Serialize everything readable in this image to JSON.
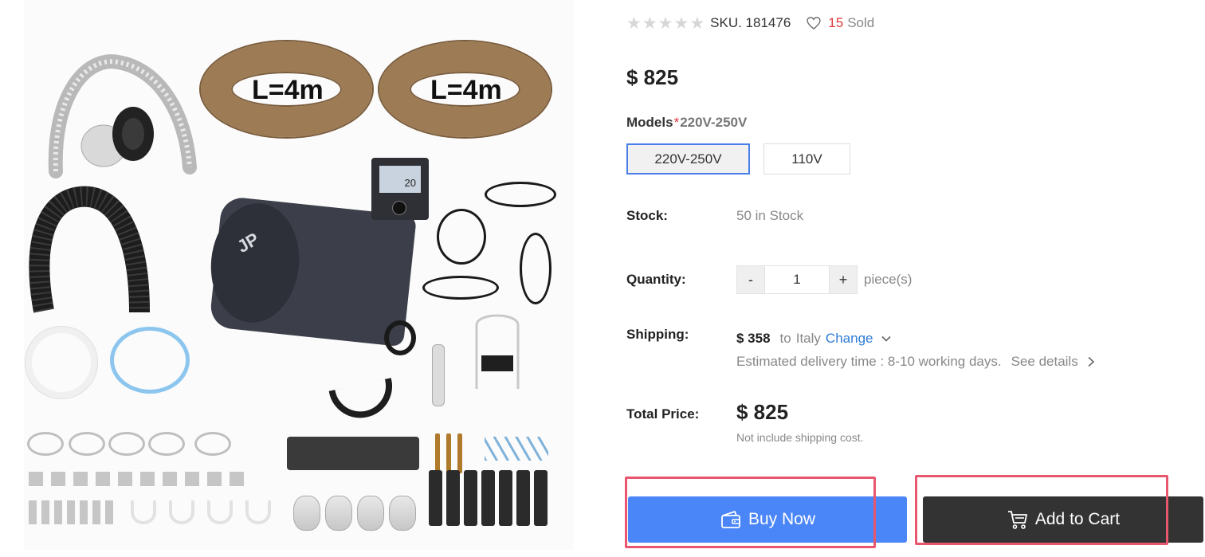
{
  "product": {
    "image_alt_text": "L=4m",
    "thermostat_display": "20",
    "heater_brand": "JP"
  },
  "meta": {
    "rating": 0,
    "max_rating": 5,
    "sku": "SKU. 181476",
    "sold_count": "15",
    "sold_label": "Sold"
  },
  "price": "$ 825",
  "models": {
    "label": "Models",
    "required_mark": "*",
    "selected": "220V-250V",
    "options": [
      "220V-250V",
      "110V"
    ]
  },
  "stock": {
    "label": "Stock:",
    "value": "50 in Stock"
  },
  "quantity": {
    "label": "Quantity:",
    "minus": "-",
    "value": "1",
    "plus": "+",
    "unit": "piece(s)"
  },
  "shipping": {
    "label": "Shipping:",
    "price": "$ 358",
    "to": "to",
    "country": "Italy",
    "change": "Change",
    "delivery": "Estimated delivery time : 8-10 working days.",
    "see_details": "See details"
  },
  "total": {
    "label": "Total Price:",
    "value": "$ 825",
    "note": "Not include shipping cost."
  },
  "actions": {
    "buy_now": "Buy Now",
    "add_to_cart": "Add to Cart"
  },
  "colors": {
    "buy_button": "#4a86f7",
    "cart_button": "#333333",
    "highlight": "#e8576d",
    "sold_accent": "#e4393c",
    "link": "#2e7bd6"
  },
  "icons": [
    "star-icon",
    "heart-icon",
    "chevron-down-icon",
    "chevron-right-icon",
    "wallet-icon",
    "cart-icon"
  ]
}
